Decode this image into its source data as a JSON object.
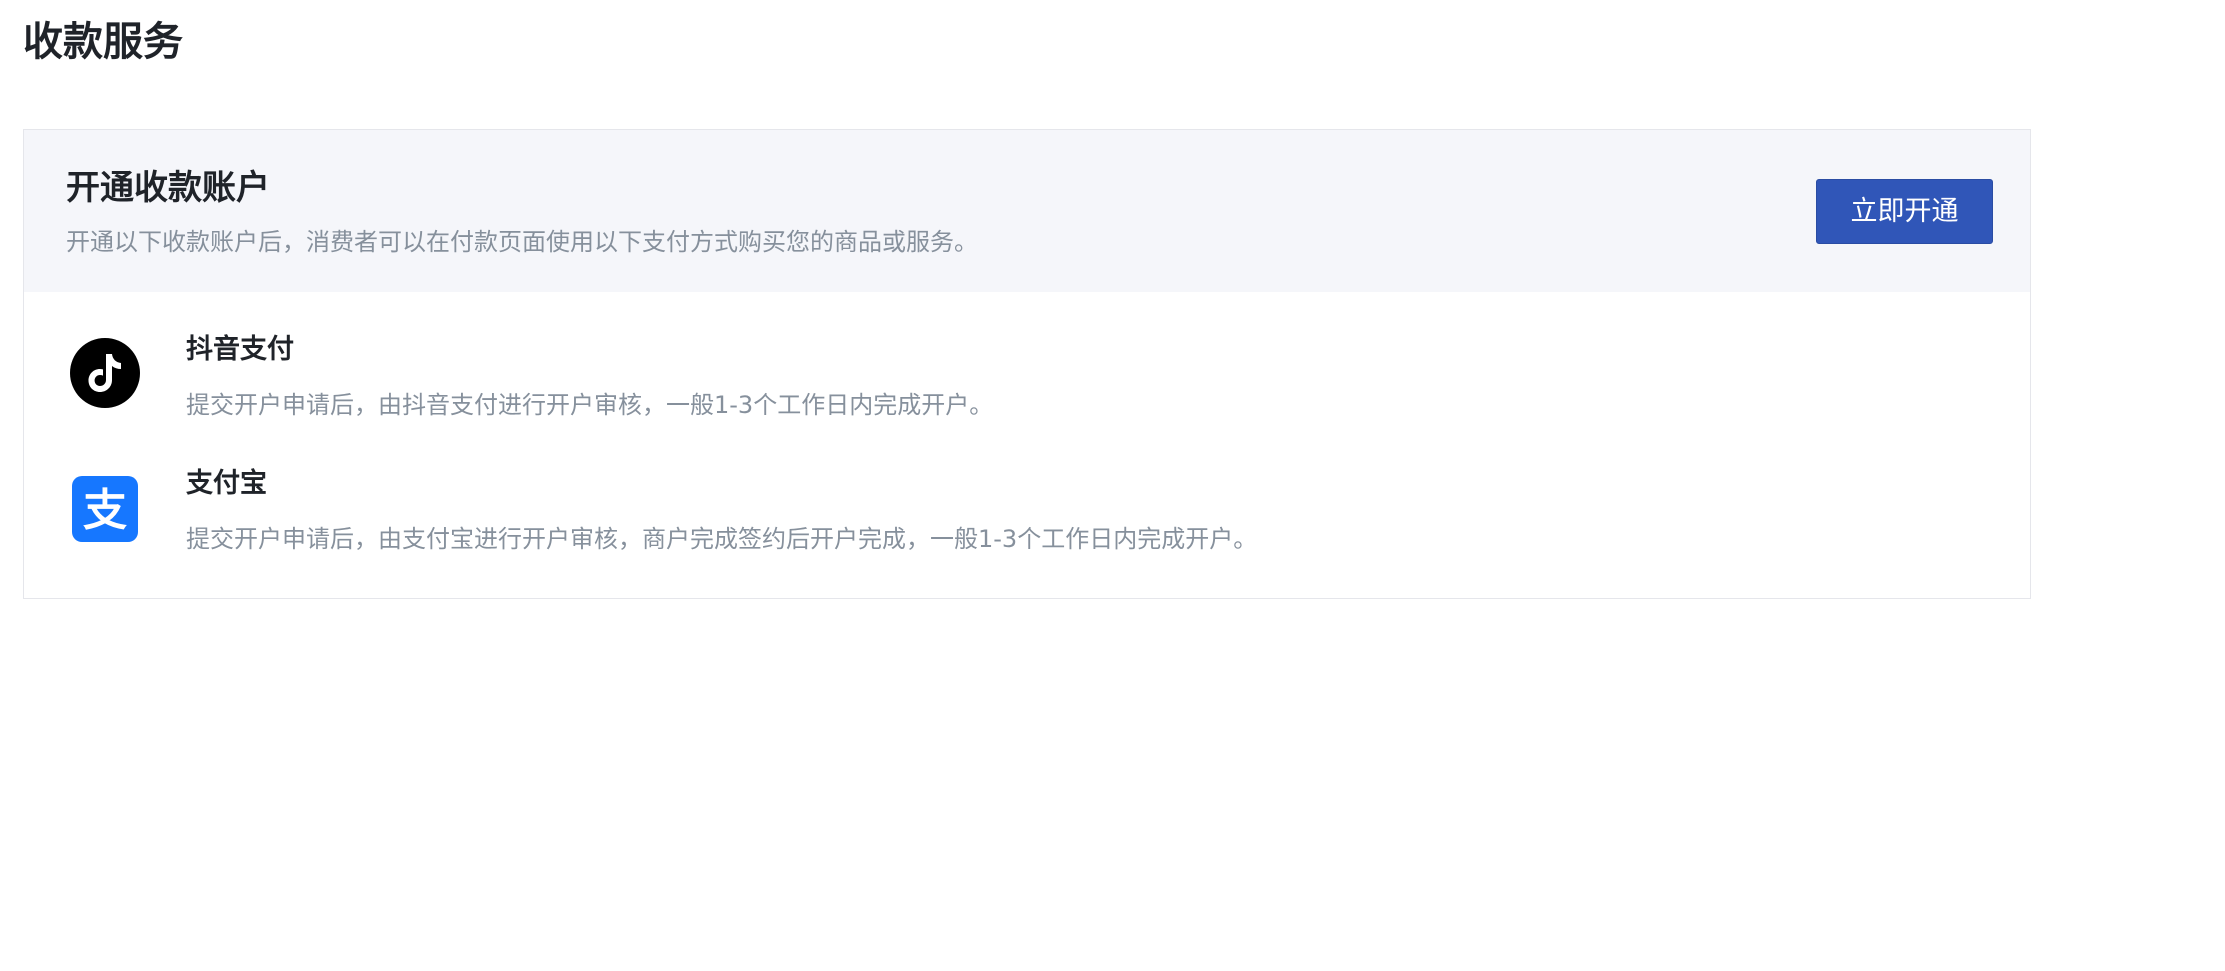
{
  "page": {
    "title": "收款服务"
  },
  "card": {
    "title": "开通收款账户",
    "description": "开通以下收款账户后，消费者可以在付款页面使用以下支付方式购买您的商品或服务。",
    "open_button_label": "立即开通"
  },
  "methods": [
    {
      "name": "抖音支付",
      "description": "提交开户申请后，由抖音支付进行开户审核，一般1-3个工作日内完成开户。",
      "icon": "douyin-icon"
    },
    {
      "name": "支付宝",
      "description": "提交开户申请后，由支付宝进行开户审核，商户完成签约后开户完成，一般1-3个工作日内完成开户。",
      "icon": "alipay-icon"
    }
  ],
  "colors": {
    "accent": "#3056b8",
    "header_bg": "#f5f6fa",
    "muted_text": "#86909c",
    "alipay_blue": "#1677ff"
  }
}
